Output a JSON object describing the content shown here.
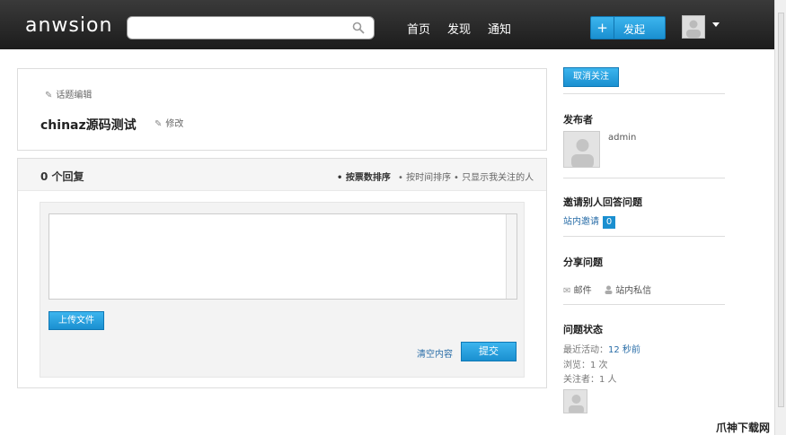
{
  "header": {
    "logo": "anwsion",
    "search_placeholder": "",
    "nav": {
      "home": "首页",
      "discover": "发现",
      "notify": "通知"
    },
    "publish_plus": "+",
    "publish_label": "发起"
  },
  "question": {
    "edit_topic": "话题编辑",
    "title": "chinaz源码测试",
    "modify": "修改"
  },
  "answers": {
    "count_label": "0 个回复",
    "sort_votes": "• 按票数排序",
    "sort_time": "• 按时间排序",
    "sort_follow": "• 只显示我关注的人",
    "upload_label": "上传文件",
    "clear_label": "清空内容",
    "submit_label": "提交"
  },
  "sidebar": {
    "unfollow_label": "取消关注",
    "publisher_heading": "发布者",
    "publisher_name": "admin",
    "invite_heading": "邀请别人回答问题",
    "invite_label": "站内邀请",
    "invite_count": "0",
    "share_heading": "分享问题",
    "share_mail": "邮件",
    "share_pm": "站内私信",
    "status_heading": "问题状态",
    "recent_activity_label": "最近活动：",
    "recent_activity_value": "12 秒前",
    "views_label": "浏览：1 次",
    "followers_label": "关注者：1 人"
  },
  "watermark": "爪神下载网",
  "colors": {
    "accent": "#1a8fd0",
    "topbar": "#2a2a2a",
    "link": "#2a6ea8"
  }
}
